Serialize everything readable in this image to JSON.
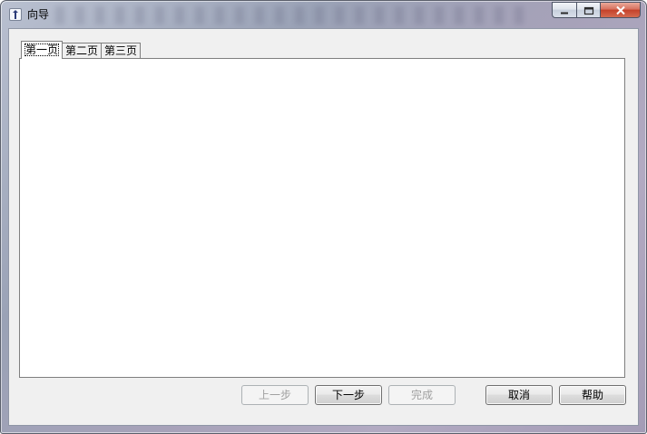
{
  "window": {
    "title": "向导"
  },
  "tabs": [
    {
      "label": "第一页",
      "active": true
    },
    {
      "label": "第二页",
      "active": false
    },
    {
      "label": "第三页",
      "active": false
    }
  ],
  "buttons": {
    "prev": "上一步",
    "next": "下一步",
    "finish": "完成",
    "cancel": "取消",
    "help": "帮助"
  },
  "icons": {
    "app": "wizard-app-icon",
    "minimize": "minimize-icon",
    "maximize": "maximize-icon",
    "close": "close-icon"
  },
  "colors": {
    "close_button": "#c4412a",
    "client_background": "#f0f0f0",
    "disabled_text": "#a0a0a0"
  }
}
